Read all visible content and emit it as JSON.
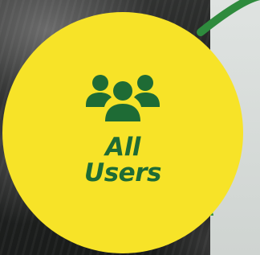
{
  "badge": {
    "line1": "All",
    "line2": "Users",
    "icon": "users-group-icon",
    "fill_color": "#f7e328",
    "text_color": "#1e6b35"
  },
  "accent": {
    "arc_color": "#2e8b3d"
  }
}
